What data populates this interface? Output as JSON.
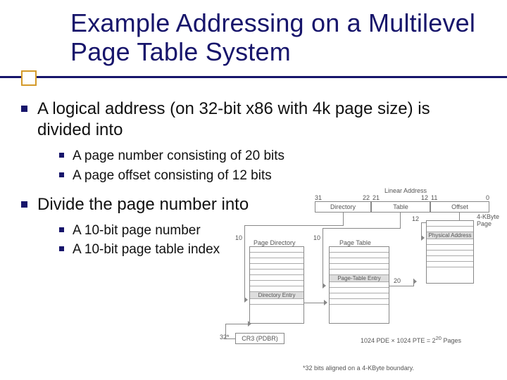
{
  "title": "Example Addressing on a Multilevel Page Table System",
  "bullets": {
    "b1": "A logical address (on 32-bit x86 with 4k page size) is divided into",
    "b1a": "A page number consisting of 20 bits",
    "b1b": "A page offset consisting of 12 bits",
    "b2": "Divide the page number into",
    "b2a": "A 10-bit page number",
    "b2b": "A 10-bit page table index"
  },
  "diagram": {
    "top_label": "Linear Address",
    "bits": {
      "b31": "31",
      "b22": "22",
      "b21": "21",
      "b12": "12",
      "b11": "11",
      "b0": "0"
    },
    "fields": {
      "dir": "Directory",
      "tbl": "Table",
      "off": "Offset"
    },
    "widths": {
      "dir": "10",
      "tbl": "10",
      "off": "12"
    },
    "page_label": "4-KByte Page",
    "phys": "Physical Address",
    "pd_label": "Page Directory",
    "dir_entry": "Directory Entry",
    "cr3": "CR3 (PDBR)",
    "cr3_note": "32*",
    "pt_label": "Page Table",
    "pt_entry": "Page-Table Entry",
    "pde_note_a": "1024 PDE",
    "pde_note_mul": "×",
    "pde_note_b": "1024 PTE = 2",
    "pde_note_exp": "20",
    "pde_note_c": " Pages",
    "pt_count": "20",
    "footnote": "*32 bits aligned on a 4-KByte boundary."
  }
}
